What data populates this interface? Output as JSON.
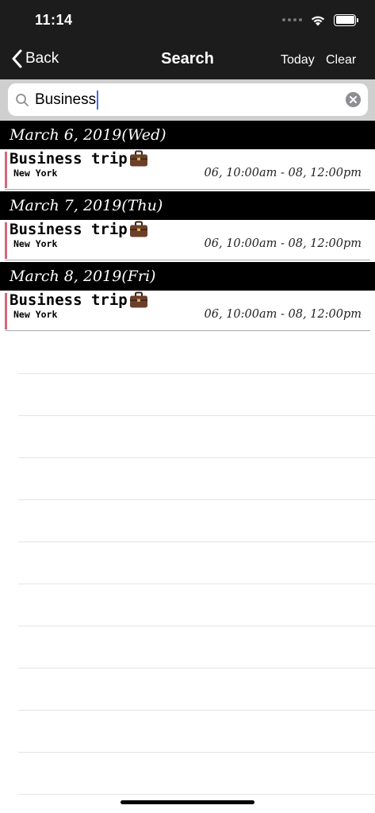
{
  "status_bar": {
    "time": "11:14"
  },
  "nav": {
    "back_label": "Back",
    "title": "Search",
    "today_label": "Today",
    "clear_label": "Clear"
  },
  "search": {
    "value": "Business"
  },
  "sections": [
    {
      "date": "March 6, 2019(Wed)",
      "event": {
        "title": "Business trip",
        "location": "New York",
        "time": "06, 10:00am - 08, 12:00pm",
        "icon": "briefcase-icon"
      }
    },
    {
      "date": "March 7, 2019(Thu)",
      "event": {
        "title": "Business trip",
        "location": "New York",
        "time": "06, 10:00am - 08, 12:00pm",
        "icon": "briefcase-icon"
      }
    },
    {
      "date": "March 8, 2019(Fri)",
      "event": {
        "title": "Business trip",
        "location": "New York",
        "time": "06, 10:00am - 08, 12:00pm",
        "icon": "briefcase-icon"
      }
    }
  ],
  "colors": {
    "bar_background": "#1c1c1c",
    "event_accent": "#d2687c",
    "caret": "#3b6cf6"
  }
}
